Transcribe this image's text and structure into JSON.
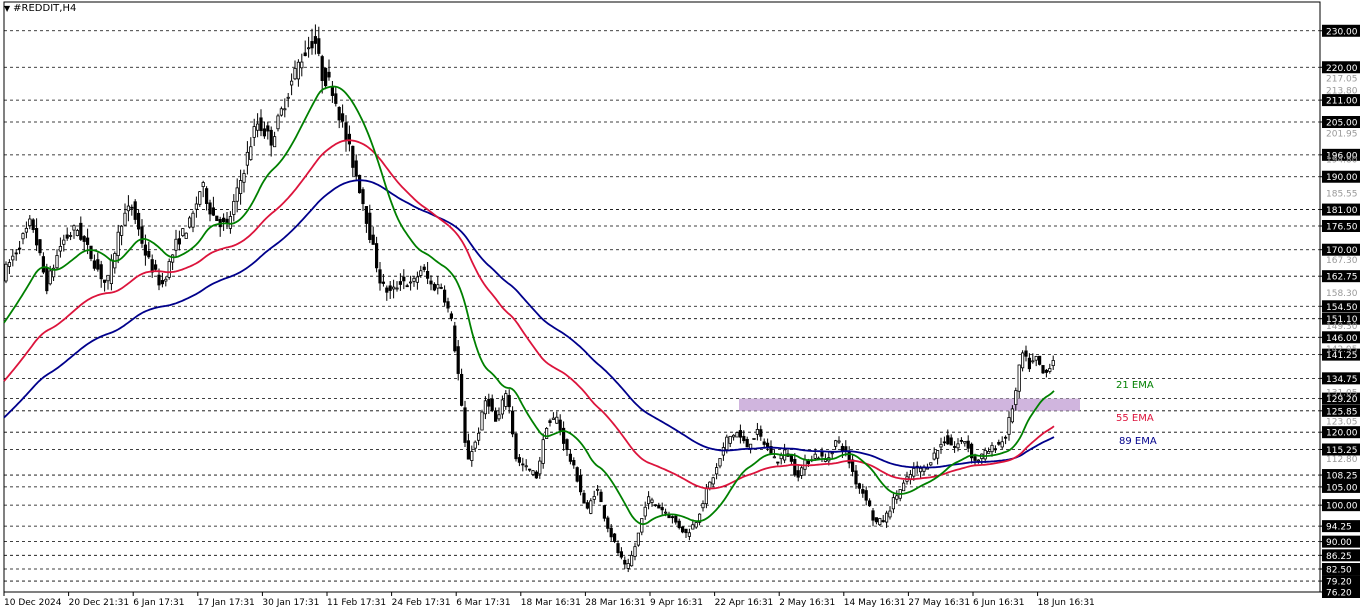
{
  "header": {
    "symbol_label": "#REDDIT,H4",
    "menu_arrow": "▼"
  },
  "legend": {
    "ema21": {
      "label": "21 EMA",
      "color": "#008000"
    },
    "ema55": {
      "label": "55 EMA",
      "color": "#dc143c"
    },
    "ema89": {
      "label": "89 EMA",
      "color": "#00008b"
    }
  },
  "colors": {
    "candle": "#000000",
    "grid": "#000000",
    "zone": "#c8a8d8",
    "axis": "#000000"
  },
  "chart_data": {
    "type": "candlestick",
    "title": "#REDDIT,H4",
    "y_axis": {
      "range": [
        76.2,
        233.5
      ],
      "labels": [
        "230.00",
        "220.00",
        "211.00",
        "205.00",
        "196.00",
        "190.00",
        "181.00",
        "176.50",
        "170.00",
        "162.75",
        "154.50",
        "151.10",
        "146.00",
        "141.25",
        "134.75",
        "129.20",
        "125.85",
        "120.00",
        "115.25",
        "108.25",
        "105.00",
        "100.00",
        "94.25",
        "90.00",
        "86.25",
        "82.50",
        "79.20",
        "76.20"
      ],
      "faint_labels": [
        "217.05",
        "213.80",
        "201.95",
        "194.80",
        "185.55",
        "167.30",
        "158.30",
        "149.30",
        "142.95",
        "131.05",
        "123.05",
        "112.80"
      ]
    },
    "x_axis": {
      "labels": [
        "10 Dec 2024",
        "20 Dec 21:31",
        "6 Jan 17:31",
        "17 Jan 17:31",
        "30 Jan 17:31",
        "11 Feb 17:31",
        "24 Feb 17:31",
        "6 Mar 17:31",
        "18 Mar 16:31",
        "28 Mar 16:31",
        "9 Apr 16:31",
        "22 Apr 16:31",
        "2 May 16:31",
        "14 May 16:31",
        "27 May 16:31",
        "6 Jun 16:31",
        "18 Jun 16:31"
      ]
    },
    "zone": {
      "low": 125.85,
      "high": 129.2,
      "from_index": 174,
      "to_index": 262
    },
    "series": [
      {
        "name": "21 EMA",
        "key": "ema21"
      },
      {
        "name": "55 EMA",
        "key": "ema55"
      },
      {
        "name": "89 EMA",
        "key": "ema89"
      }
    ],
    "ema_values": {
      "ema21": [
        [
          0,
          148
        ],
        [
          10,
          162
        ],
        [
          20,
          166
        ],
        [
          30,
          167
        ],
        [
          40,
          172
        ],
        [
          50,
          166
        ],
        [
          60,
          178
        ],
        [
          70,
          176
        ],
        [
          80,
          178
        ],
        [
          90,
          206
        ],
        [
          100,
          214
        ],
        [
          110,
          204
        ],
        [
          120,
          186
        ],
        [
          130,
          172
        ],
        [
          140,
          170
        ],
        [
          150,
          166
        ],
        [
          160,
          158
        ],
        [
          170,
          150
        ],
        [
          180,
          132
        ],
        [
          190,
          123
        ],
        [
          200,
          118
        ],
        [
          210,
          115
        ],
        [
          220,
          112
        ],
        [
          240,
          118
        ],
        [
          250,
          120
        ],
        [
          260,
          118
        ],
        [
          280,
          103
        ],
        [
          300,
          96
        ],
        [
          320,
          110
        ],
        [
          340,
          122
        ],
        [
          360,
          128
        ],
        [
          376,
          146
        ],
        [
          400,
          152
        ],
        [
          420,
          170
        ],
        [
          440,
          188
        ],
        [
          460,
          202
        ],
        [
          480,
          212
        ],
        [
          500,
          222
        ],
        [
          520,
          230
        ],
        [
          540,
          240
        ],
        [
          560,
          248
        ],
        [
          580,
          256
        ],
        [
          600,
          262
        ],
        [
          620,
          268
        ],
        [
          640,
          276
        ],
        [
          660,
          286
        ],
        [
          680,
          298
        ],
        [
          700,
          310
        ],
        [
          720,
          322
        ],
        [
          740,
          332
        ],
        [
          760,
          338
        ],
        [
          780,
          344
        ],
        [
          800,
          348
        ],
        [
          820,
          356
        ],
        [
          840,
          362
        ],
        [
          860,
          368
        ],
        [
          880,
          372
        ],
        [
          900,
          376
        ]
      ],
      "ema55": [
        [
          0,
          0
        ]
      ]
    },
    "ema_points": {
      "ema21": [
        [
          0,
          148
        ],
        [
          12,
          160
        ],
        [
          24,
          165
        ],
        [
          36,
          166
        ],
        [
          48,
          168
        ],
        [
          60,
          163
        ],
        [
          70,
          166
        ],
        [
          80,
          170
        ],
        [
          90,
          172
        ],
        [
          100,
          178
        ],
        [
          110,
          176
        ],
        [
          120,
          175
        ],
        [
          130,
          180
        ],
        [
          140,
          190
        ],
        [
          150,
          198
        ],
        [
          160,
          208
        ],
        [
          170,
          213
        ],
        [
          176,
          211
        ],
        [
          182,
          207
        ],
        [
          188,
          199
        ],
        [
          196,
          188
        ],
        [
          204,
          179
        ],
        [
          212,
          173
        ],
        [
          220,
          170
        ],
        [
          228,
          168
        ],
        [
          236,
          164
        ],
        [
          244,
          158
        ],
        [
          252,
          150
        ],
        [
          260,
          140
        ],
        [
          268,
          131
        ],
        [
          276,
          125
        ],
        [
          284,
          122
        ],
        [
          292,
          121
        ],
        [
          300,
          119
        ],
        [
          308,
          117
        ],
        [
          316,
          113
        ],
        [
          324,
          110
        ],
        [
          332,
          106
        ],
        [
          340,
          103
        ],
        [
          348,
          101
        ],
        [
          356,
          99
        ],
        [
          362,
          97
        ],
        [
          368,
          97.5
        ],
        [
          376,
          101
        ],
        [
          386,
          106
        ],
        [
          396,
          110
        ],
        [
          406,
          112
        ],
        [
          416,
          113
        ],
        [
          426,
          114.5
        ],
        [
          436,
          113
        ],
        [
          446,
          112
        ],
        [
          456,
          110
        ],
        [
          464,
          107
        ],
        [
          472,
          105
        ],
        [
          480,
          106
        ],
        [
          488,
          107.5
        ],
        [
          496,
          109
        ],
        [
          506,
          111
        ],
        [
          516,
          112
        ],
        [
          524,
          113
        ],
        [
          532,
          114
        ],
        [
          538,
          115.5
        ],
        [
          546,
          121
        ],
        [
          552,
          126
        ],
        [
          558,
          129.2
        ]
      ]
    }
  }
}
